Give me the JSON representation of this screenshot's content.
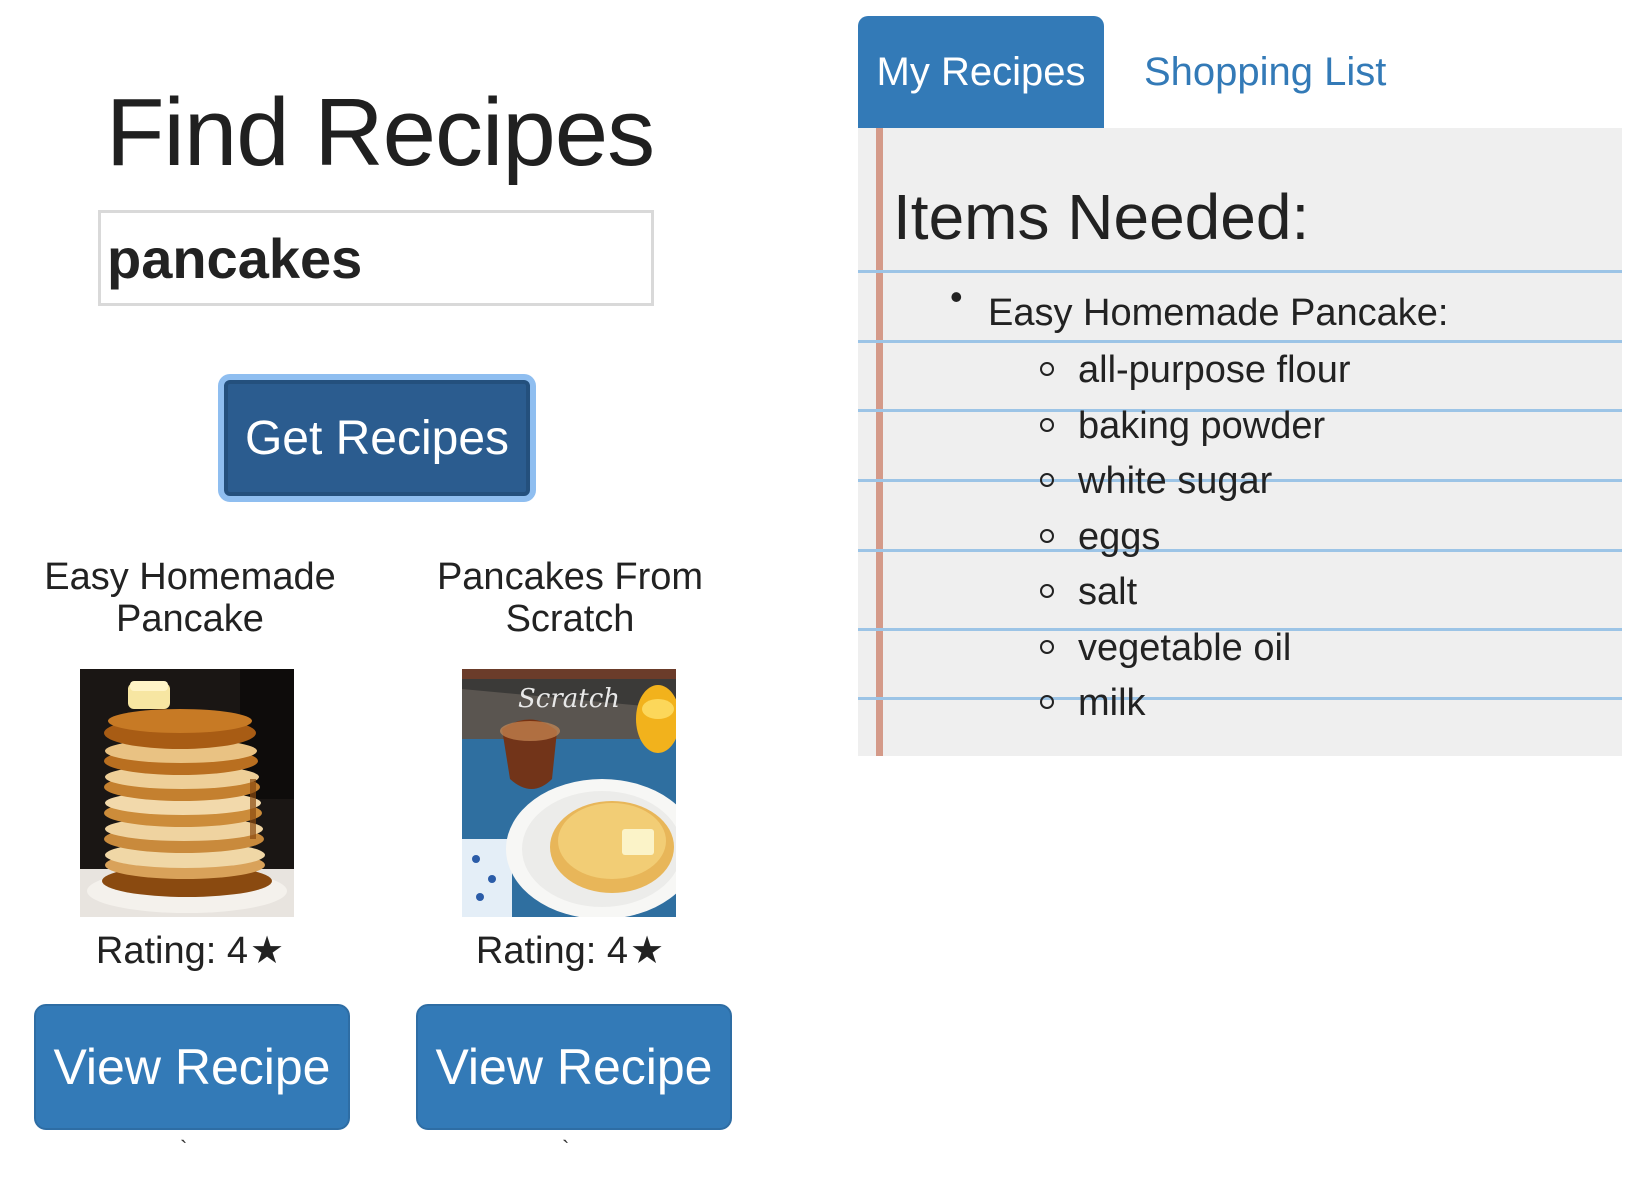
{
  "search": {
    "title": "Find Recipes",
    "query": "pancakes",
    "button_label": "Get Recipes"
  },
  "results": [
    {
      "title": "Easy Homemade Pancake",
      "rating_label": "Rating: 4",
      "rating_value": 4,
      "star": "★",
      "button_label": "View Recipe",
      "image": "stacked-pancakes-photo"
    },
    {
      "title": "Pancakes From Scratch",
      "rating_label": "Rating: 4",
      "rating_value": 4,
      "star": "★",
      "button_label": "View Recipe",
      "image": "pancakes-from-scratch-photo",
      "image_caption": "Scratch"
    }
  ],
  "tabs": [
    {
      "label": "My Recipes",
      "active": true
    },
    {
      "label": "Shopping List",
      "active": false
    }
  ],
  "shopping_list": {
    "heading": "Items Needed:",
    "recipes": [
      {
        "name": "Easy Homemade Pancake:",
        "ingredients": [
          "all-purpose flour",
          "baking powder",
          "white sugar",
          "eggs",
          "salt",
          "vegetable oil",
          "milk"
        ]
      }
    ]
  },
  "colors": {
    "primary": "#337ab7",
    "primary_dark": "#2b5c8f",
    "notepad_bg": "#efefef",
    "rule_line": "#9cc4e6",
    "margin_line": "#d49a89"
  }
}
